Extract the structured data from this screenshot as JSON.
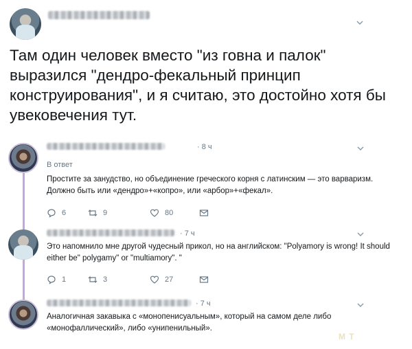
{
  "main_tweet": {
    "text": "Там один человек вместо \"из говна и палок\" выразился \"дендро-фекальный принцип конструирования\", и я считаю, это достойно хотя бы увековечения тут."
  },
  "replies": [
    {
      "time": "· 8 ч",
      "in_reply_label": "В ответ",
      "text": "Простите за занудство, но объединение греческого корня с латинским — это варваризм. Должно быть или «дендро»+«копро», или «арбор»+«фекал».",
      "replies_count": "6",
      "retweets_count": "9",
      "likes_count": "80"
    },
    {
      "time": "· 7 ч",
      "text": "Это напомнило мне другой чудесный прикол, но на английском: \"Polyamory is wrong! It should either be\" polygamy\" or \"multiamory\". \"",
      "replies_count": "1",
      "retweets_count": "3",
      "likes_count": "27"
    },
    {
      "time": "· 7 ч",
      "text": "Аналогичная закавыка с «монопенисуальным», который на самом деле либо «монофаллический», либо «унипенильный»."
    }
  ],
  "watermark": "M T",
  "icons": {
    "reply": "speech-bubble-icon",
    "retweet": "retweet-icon",
    "like": "heart-icon",
    "dm": "envelope-icon",
    "more": "chevron-down-icon"
  },
  "colors": {
    "thread_line": "#c7a6e0",
    "secondary_text": "#657786"
  }
}
